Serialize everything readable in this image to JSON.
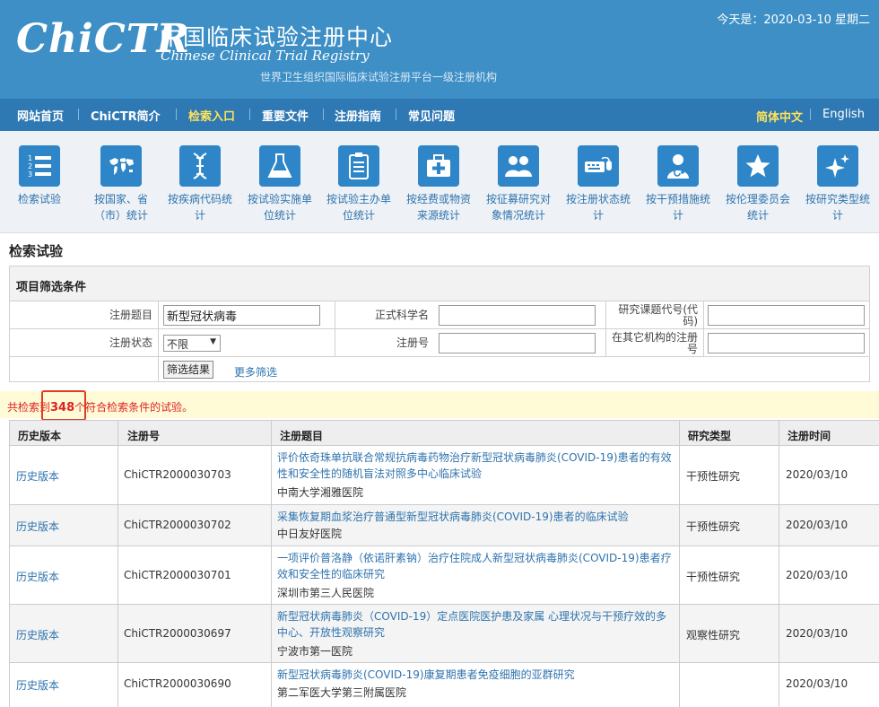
{
  "header": {
    "logo_text": "ChiCTR",
    "title_cn": "中国临床试验注册中心",
    "title_en": "Chinese Clinical Trial Registry",
    "subtitle": "世界卫生组织国际临床试验注册平台一级注册机构",
    "today": "今天是：2020-03-10 星期二"
  },
  "nav": {
    "items": [
      "网站首页",
      "ChiCTR简介",
      "检索入口",
      "重要文件",
      "注册指南",
      "常见问题"
    ],
    "active_index": 2,
    "lang_cn": "简体中文",
    "lang_en": "English"
  },
  "iconbar": {
    "items": [
      {
        "label": "检索试验",
        "icon": "list-icon"
      },
      {
        "label": "按国家、省（市）统计",
        "icon": "world-map-icon"
      },
      {
        "label": "按疾病代码统计",
        "icon": "dna-icon"
      },
      {
        "label": "按试验实施单位统计",
        "icon": "flask-icon"
      },
      {
        "label": "按试验主办单位统计",
        "icon": "clipboard-icon"
      },
      {
        "label": "按经费或物资来源统计",
        "icon": "medical-kit-icon"
      },
      {
        "label": "按征募研究对象情况统计",
        "icon": "people-icon"
      },
      {
        "label": "按注册状态统计",
        "icon": "keyboard-mouse-icon"
      },
      {
        "label": "按干预措施统计",
        "icon": "doctor-icon"
      },
      {
        "label": "按伦理委员会统计",
        "icon": "star-icon"
      },
      {
        "label": "按研究类型统计",
        "icon": "sparkle-icon"
      }
    ]
  },
  "page_title": "检索试验",
  "filter": {
    "heading": "项目筛选条件",
    "reg_title_label": "注册题目",
    "reg_title_value": "新型冠状病毒",
    "sci_name_label": "正式科学名",
    "sci_name_value": "",
    "project_code_label": "研究课题代号(代码)",
    "project_code_value": "",
    "status_label": "注册状态",
    "status_value": "不限",
    "reg_no_label": "注册号",
    "reg_no_value": "",
    "other_reg_label": "在其它机构的注册号",
    "other_reg_value": "",
    "submit_label": "筛选结果",
    "more_label": "更多筛选"
  },
  "result": {
    "prefix": "共检索到",
    "count": "348",
    "suffix": "个符合检索条件的试验。"
  },
  "table": {
    "headers": [
      "历史版本",
      "注册号",
      "注册题目",
      "研究类型",
      "注册时间"
    ],
    "rows": [
      {
        "hist": "历史版本",
        "reg_no": "ChiCTR2000030703",
        "title": "评价依奇珠单抗联合常规抗病毒药物治疗新型冠状病毒肺炎(COVID-19)患者的有效性和安全性的随机盲法对照多中心临床试验",
        "institution": "中南大学湘雅医院",
        "type": "干预性研究",
        "date": "2020/03/10"
      },
      {
        "hist": "历史版本",
        "reg_no": "ChiCTR2000030702",
        "title": "采集恢复期血浆治疗普通型新型冠状病毒肺炎(COVID-19)患者的临床试验",
        "institution": "中日友好医院",
        "type": "干预性研究",
        "date": "2020/03/10"
      },
      {
        "hist": "历史版本",
        "reg_no": "ChiCTR2000030701",
        "title": "一项评价普洛静（依诺肝素钠）治疗住院成人新型冠状病毒肺炎(COVID-19)患者疗效和安全性的临床研究",
        "institution": "深圳市第三人民医院",
        "type": "干预性研究",
        "date": "2020/03/10"
      },
      {
        "hist": "历史版本",
        "reg_no": "ChiCTR2000030697",
        "title": "新型冠状病毒肺炎（COVID-19）定点医院医护患及家属 心理状况与干预疗效的多中心、开放性观察研究",
        "institution": "宁波市第一医院",
        "type": "观察性研究",
        "date": "2020/03/10"
      },
      {
        "hist": "历史版本",
        "reg_no": "ChiCTR2000030690",
        "title": "新型冠状病毒肺炎(COVID-19)康复期患者免疫细胞的亚群研究",
        "institution": "第二军医大学第三附属医院",
        "type": "",
        "date": "2020/03/10"
      }
    ]
  }
}
